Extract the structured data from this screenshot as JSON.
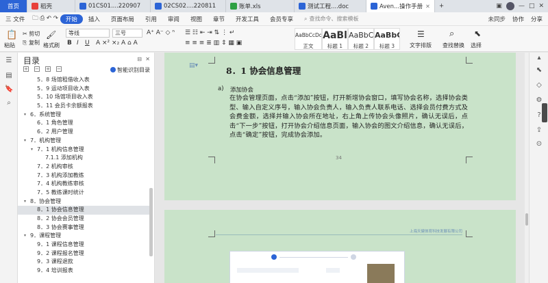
{
  "tabs": [
    {
      "label": "首页",
      "kind": "home"
    },
    {
      "label": "稻壳",
      "icon_color": "#e8413a"
    },
    {
      "label": "01CS01....220907",
      "icon_color": "#2c64d6"
    },
    {
      "label": "02CS02....220811",
      "icon_color": "#2c64d6"
    },
    {
      "label": "账单.xls",
      "icon_color": "#2ea043"
    },
    {
      "label": "测试工程....doc",
      "icon_color": "#2c64d6"
    },
    {
      "label": "Aven...操作手册",
      "icon_color": "#2c64d6",
      "active": true
    }
  ],
  "menubar": {
    "file": "三 文件",
    "items": [
      "开始",
      "插入",
      "页面布局",
      "引用",
      "审阅",
      "视图",
      "章节",
      "开发工具",
      "会员专享"
    ],
    "search_placeholder": "查找命令、搜索模板",
    "right": [
      "未同步",
      "协作",
      "分享"
    ]
  },
  "ribbon": {
    "paste": "粘贴",
    "cut": "剪切",
    "copy": "复制",
    "format_painter": "格式刷",
    "font_family": "等线",
    "font_size": "三号",
    "styles": [
      {
        "preview": "AaBbCcDd",
        "name": "正文"
      },
      {
        "preview": "AaBl",
        "name": "标题 1"
      },
      {
        "preview": "AaBbC",
        "name": "标题 2"
      },
      {
        "preview": "AaBbC",
        "name": "标题 3"
      }
    ],
    "layout_tool": "文字排版",
    "find_replace": "查找替换",
    "select": "选择"
  },
  "toc": {
    "title": "目录",
    "smart": "智能识别目录",
    "items": [
      {
        "label": "5．8 场馆租借收入表",
        "level": 2
      },
      {
        "label": "5．9 运动项目收入表",
        "level": 2
      },
      {
        "label": "5．10 场馆项目收入表",
        "level": 2
      },
      {
        "label": "5．11 会员卡余额报表",
        "level": 2
      },
      {
        "label": "6．系统管理",
        "level": 1,
        "caret": "▾"
      },
      {
        "label": "6．1 角色管理",
        "level": 2
      },
      {
        "label": "6．2 用户管理",
        "level": 2
      },
      {
        "label": "7．机构管理",
        "level": 1,
        "caret": "▾"
      },
      {
        "label": "7．1 机构信息管理",
        "level": 2,
        "caret": "▾"
      },
      {
        "label": "7.1.1 添加机构",
        "level": 3
      },
      {
        "label": "7．2 机构审核",
        "level": 2
      },
      {
        "label": "7．3 机构添加教练",
        "level": 2
      },
      {
        "label": "7．4 机构教练审核",
        "level": 2
      },
      {
        "label": "7．5 教练课时统计",
        "level": 2
      },
      {
        "label": "8．协会管理",
        "level": 1,
        "caret": "▾"
      },
      {
        "label": "8．1 协会信息管理",
        "level": 2,
        "selected": true
      },
      {
        "label": "8．2 协会会员管理",
        "level": 2
      },
      {
        "label": "8．3 协会赛事管理",
        "level": 2
      },
      {
        "label": "9．课程管理",
        "level": 1,
        "caret": "▾"
      },
      {
        "label": "9．1 课程信息管理",
        "level": 2
      },
      {
        "label": "9．2 课程报名管理",
        "level": 2
      },
      {
        "label": "9．3 课程退款",
        "level": 2
      },
      {
        "label": "9．4 培训报表",
        "level": 2
      }
    ]
  },
  "document": {
    "heading": "8．1 协会信息管理",
    "sub_marker": "a)",
    "sub_title": "添加协会",
    "paragraph": "在协会管理页面，点击“添加”按钮，打开新增协会窗口，填写协会名称，选择协会类型、输入自定义序号，输入协会负责人，输入负责人联系电话、选择会员付费方式及会费金额，选择并输入协会所在地址，右上角上传协会头像照片，确认无误后，点击“下一步”按钮，打开协会介绍信息页面，输入协会的图文介绍信息，确认无误后，点击“确定”按钮，完成协会添加。",
    "page_number": "34",
    "next_page_header": "上海天健体育科技发展有限公司"
  },
  "colors": {
    "accent": "#2c64d6",
    "page_bg": "#c9e3c9",
    "workspace_bg": "#e6e6e6"
  }
}
